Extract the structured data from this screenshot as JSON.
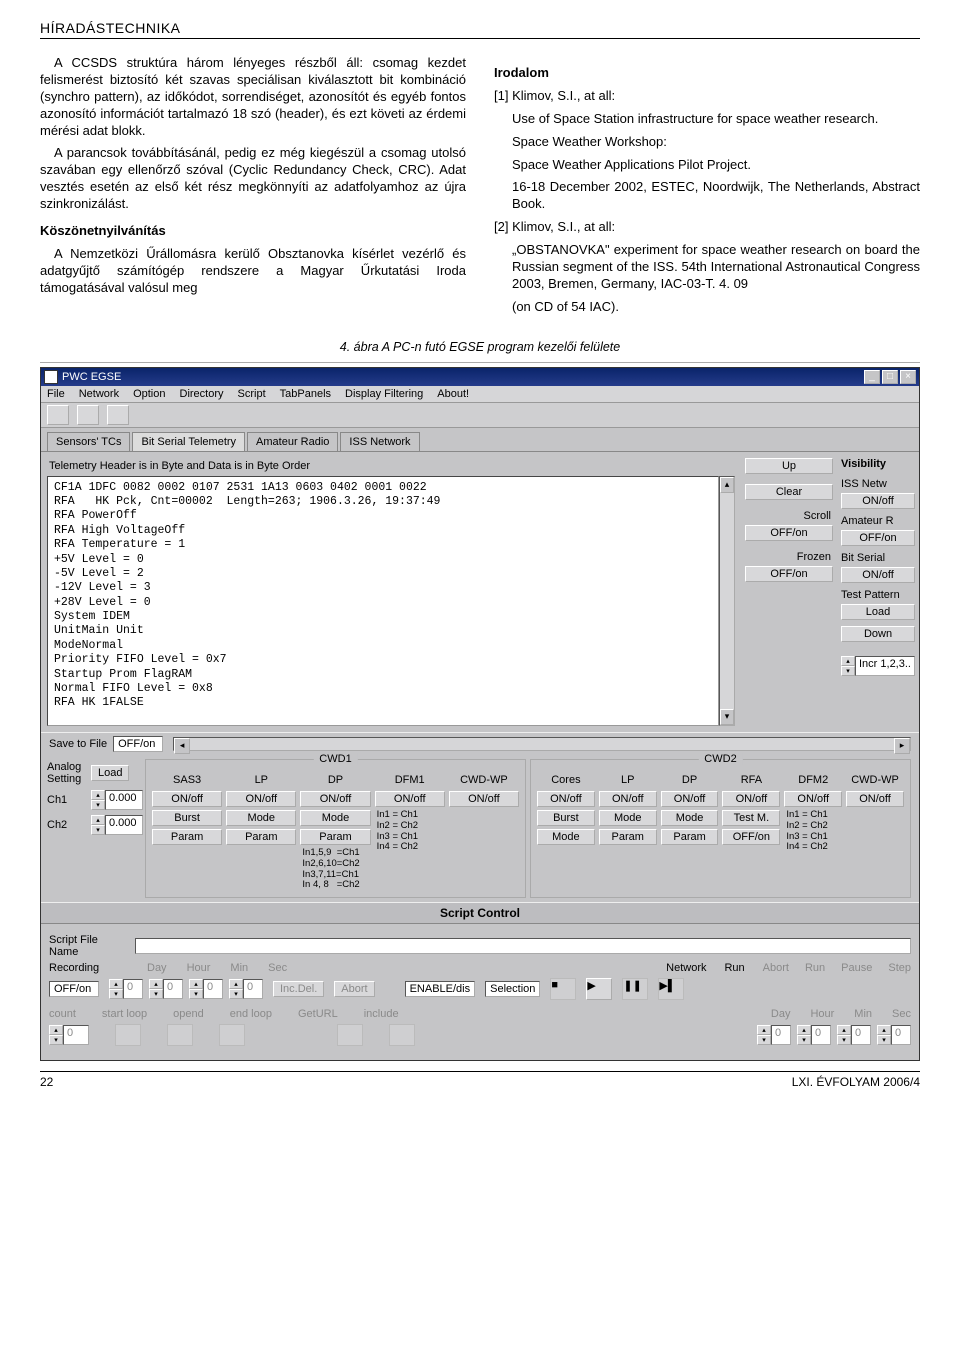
{
  "runningHead": "HÍRADÁSTECHNIKA",
  "article": {
    "p1": "A CCSDS struktúra három lényeges részből áll: csomag kezdet felismerést biztosító két szavas speciálisan kiválasztott bit kombináció (synchro pattern), az időkódot, sorrendiséget, azonosítót és egyéb fontos azonosító információt tartalmazó 18 szó (header), és ezt követi az érdemi mérési adat blokk.",
    "p2": "A parancsok továbbításánál, pedig ez még kiegészül a csomag utolsó szavában egy ellenőrző szóval (Cyclic Redundancy Check, CRC). Adat vesztés esetén az első két rész megkönnyíti az adatfolyamhoz az újra szinkronizálást.",
    "ackHead": "Köszönetnyilvánítás",
    "ack": "A Nemzetközi Űrállomásra kerülő Obsztanovka kísérlet vezérlő és adatgyűjtő számítógép rendszere a Magyar Űrkutatási Iroda támogatásával valósul meg",
    "refHead": "Irodalom",
    "ref1a": "[1] Klimov, S.I., at all:",
    "ref1b": "Use of Space Station infrastructure for space weather research.",
    "ref1c": "Space Weather Workshop:",
    "ref1d": "Space Weather Applications Pilot Project.",
    "ref1e": "16-18 December 2002, ESTEC, Noordwijk, The Netherlands, Abstract Book.",
    "ref2a": "[2] Klimov, S.I., at all:",
    "ref2b": "„OBSTANOVKA\" experiment for space weather research on board the Russian segment of the ISS. 54th International Astronautical Congress 2003, Bremen, Germany, IAC-03-T. 4. 09",
    "ref2c": "(on CD of 54 IAC)."
  },
  "figCaption": "4. ábra  A PC-n futó EGSE program kezelői felülete",
  "egse": {
    "title": "PWC EGSE",
    "menus": [
      "File",
      "Network",
      "Option",
      "Directory",
      "Script",
      "TabPanels",
      "Display Filtering",
      "About!"
    ],
    "tabs": [
      "Sensors' TCs",
      "Bit Serial Telemetry",
      "Amateur Radio",
      "ISS Network"
    ],
    "activeTab": 1,
    "telemHeader": "Telemetry Header is in Byte and Data is in Byte Order",
    "telemetry": "CF1A 1DFC 0082 0002 0107 2531 1A13 0603 0402 0001 0022\nRFA   HK Pck, Cnt=00002  Length=263; 1906.3.26, 19:37:49\nRFA PowerOff\nRFA High VoltageOff\nRFA Temperature = 1\n+5V Level = 0\n-5V Level = 2\n-12V Level = 3\n+28V Level = 0\nSystem IDEM\nUnitMain Unit\nModeNormal\nPriority FIFO Level = 0x7\nStartup Prom FlagRAM\nNormal FIFO Level = 0x8\nRFA HK 1FALSE",
    "sideButtons": [
      {
        "label": "",
        "btn": "Up"
      },
      {
        "label": "",
        "btn": "Clear"
      },
      {
        "label": "Scroll",
        "btn": "OFF/on"
      },
      {
        "label": "Frozen",
        "btn": "OFF/on"
      }
    ],
    "visibility": {
      "title": "Visibility",
      "rows": [
        {
          "lab": "ISS Netw",
          "btn": "ON/off"
        },
        {
          "lab": "Amateur R",
          "btn": "OFF/on"
        },
        {
          "lab": "Bit Serial",
          "btn": "ON/off"
        },
        {
          "lab": "Test Pattern",
          "btn": "Load"
        },
        {
          "lab": "",
          "btn": "Down"
        }
      ],
      "spin": "Incr 1,2,3.."
    },
    "saveRow": {
      "lab": "Save to File",
      "val": "OFF/on"
    },
    "analog": {
      "lab": "Analog Setting",
      "btn": "Load",
      "ch1": "Ch1",
      "ch1v": "0.000",
      "ch2": "Ch2",
      "ch2v": "0.000"
    },
    "cwd1": {
      "title": "CWD1",
      "cols": [
        {
          "h": "SAS3",
          "b1": "ON/off",
          "b2": "Burst",
          "b3": "Param"
        },
        {
          "h": "LP",
          "b1": "ON/off",
          "b2": "Mode",
          "b3": "Param"
        },
        {
          "h": "DP",
          "b1": "ON/off",
          "b2": "Mode",
          "b3": "Param",
          "info": "In1,5,9  =Ch1\nIn2,6,10=Ch2\nIn3,7,11=Ch1\nIn 4, 8   =Ch2"
        },
        {
          "h": "DFM1",
          "b1": "ON/off",
          "info": "In1 = Ch1\nIn2 = Ch2\nIn3 = Ch1\nIn4 = Ch2"
        },
        {
          "h": "CWD-WP",
          "b1": "ON/off"
        }
      ]
    },
    "cwd2": {
      "title": "CWD2",
      "cols": [
        {
          "h": "Cores",
          "b1": "ON/off",
          "b2": "Burst",
          "b3": "Mode"
        },
        {
          "h": "LP",
          "b1": "ON/off",
          "b2": "Mode",
          "b3": "Param"
        },
        {
          "h": "DP",
          "b1": "ON/off",
          "b2": "Mode",
          "b3": "Param"
        },
        {
          "h": "RFA",
          "b1": "ON/off",
          "b3": "Test M.",
          "tbtn": "OFF/on"
        },
        {
          "h": "DFM2",
          "b1": "ON/off",
          "info": "In1 = Ch1\nIn2 = Ch2\nIn3 = Ch1\nIn4 = Ch2"
        },
        {
          "h": "CWD-WP",
          "b1": "ON/off"
        }
      ]
    },
    "scriptControl": {
      "title": "Script Control",
      "fileNameLab": "Script File Name",
      "recordingLab": "Recording",
      "recordingVal": "OFF/on",
      "timeHeads": [
        "Day",
        "Hour",
        "Min",
        "Sec"
      ],
      "btns": [
        "Inc.Del.",
        "Abort"
      ],
      "networkLab": "Network",
      "networkVal": "ENABLE/dis",
      "runLab": "Run",
      "runVal": "Selection",
      "playHeads": [
        "Abort",
        "Run",
        "Pause",
        "Step"
      ],
      "bottom": [
        "count",
        "start loop",
        "opend",
        "end loop",
        "GetURL",
        "include"
      ],
      "timeHeads2": [
        "Day",
        "Hour",
        "Min",
        "Sec"
      ]
    }
  },
  "footer": {
    "left": "22",
    "right": "LXI. ÉVFOLYAM 2006/4"
  }
}
